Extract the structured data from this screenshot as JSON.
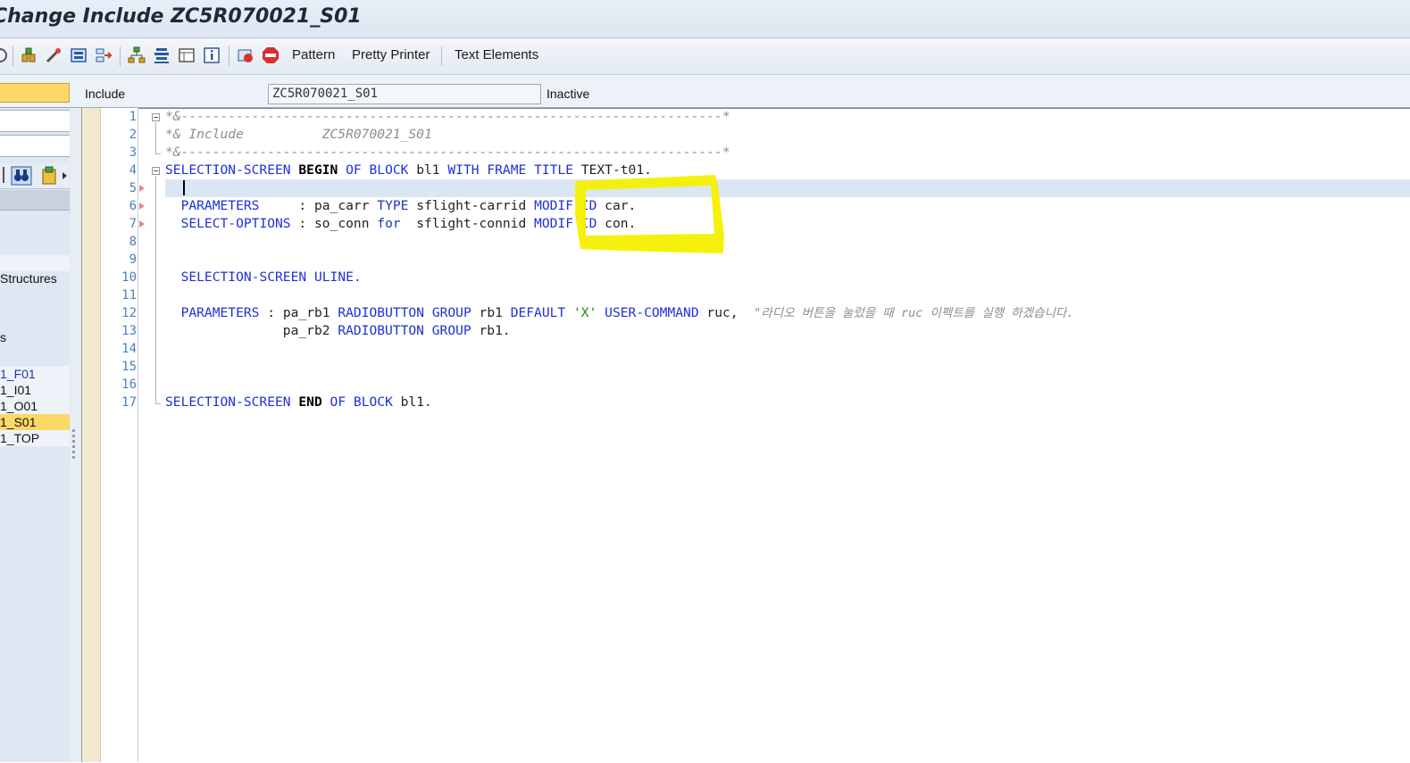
{
  "window": {
    "title": "Change Include ZC5R070021_S01"
  },
  "toolbar": {
    "icons": [
      "display-object-icon",
      "other-object-icon",
      "where-used-icon",
      "enhance-icon",
      "navigate-icon",
      "hierarchy-icon",
      "stack-icon",
      "object-list-icon",
      "info-icon",
      "breakpoint-icon",
      "stop-icon"
    ],
    "pattern_label": "Pattern",
    "pretty_printer_label": "Pretty Printer",
    "text_elements_label": "Text Elements"
  },
  "header": {
    "type_label": "Include",
    "object_name": "ZC5R070021_S01",
    "status": "Inactive"
  },
  "navigator": {
    "structures_label": "Structures",
    "s_label": "s",
    "items": [
      "1_F01",
      "1_I01",
      "1_O01",
      "1_S01",
      "1_TOP"
    ],
    "selected_index": 3
  },
  "editor": {
    "line_numbers": [
      "1",
      "2",
      "3",
      "4",
      "5",
      "6",
      "7",
      "8",
      "9",
      "10",
      "11",
      "12",
      "13",
      "14",
      "15",
      "16",
      "17"
    ],
    "code": {
      "l1": "*&---------------------------------------------------------------------*",
      "l2": "*& Include          ZC5R070021_S01",
      "l3": "*&---------------------------------------------------------------------*",
      "l4": {
        "t1": "SELECTION-SCREEN",
        "t2": "BEGIN",
        "t3": "OF",
        "t4": "BLOCK",
        "t5": "bl1",
        "t6": "WITH",
        "t7": "FRAME",
        "t8": "TITLE",
        "t9": "TEXT-t01."
      },
      "l6": {
        "t1": "PARAMETERS",
        "t2": ":",
        "t3": "pa_carr",
        "t4": "TYPE",
        "t5": "sflight-carrid",
        "t6": "MODIF",
        "t7": "ID",
        "t8": "car."
      },
      "l7": {
        "t1": "SELECT-OPTIONS",
        "t2": ":",
        "t3": "so_conn",
        "t4": "for",
        "t5": "sflight-connid",
        "t6": "MODIF",
        "t7": "ID",
        "t8": "con."
      },
      "l10": {
        "t1": "SELECTION-SCREEN",
        "t2": "ULINE."
      },
      "l12": {
        "t1": "PARAMETERS",
        "t2": ":",
        "t3": "pa_rb1",
        "t4": "RADIOBUTTON",
        "t5": "GROUP",
        "t6": "rb1",
        "t7": "DEFAULT",
        "t8": "'X'",
        "t9": "USER-COMMAND",
        "t10": "ruc,",
        "comment": "\"라디오 버튼을 눌렀을 때 ruc 이펙트를 실행 하겠습니다."
      },
      "l13": {
        "t1": "pa_rb2",
        "t2": "RADIOBUTTON",
        "t3": "GROUP",
        "t4": "rb1."
      },
      "l17": {
        "t1": "SELECTION-SCREEN",
        "t2": "END",
        "t3": "OF",
        "t4": "BLOCK",
        "t5": "bl1."
      }
    },
    "highlight_color": "#f4f000",
    "keyword_color": "#1f30d6"
  }
}
